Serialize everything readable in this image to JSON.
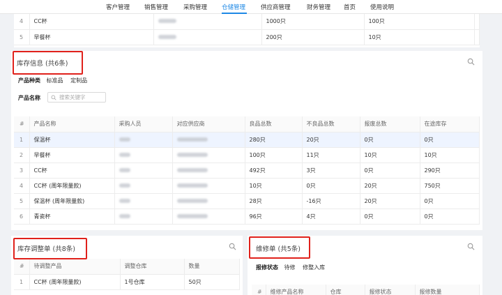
{
  "nav": {
    "items": [
      "客户管理",
      "销售管理",
      "采购管理",
      "仓储管理",
      "供应商管理",
      "财务管理",
      "首页",
      "使用说明"
    ],
    "active_index": 3
  },
  "top_table": {
    "rows": [
      {
        "idx": "4",
        "name": "CC杯",
        "qty": "1000只",
        "qty2": "100只"
      },
      {
        "idx": "5",
        "name": "早餐杯",
        "qty": "200只",
        "qty2": "10只"
      }
    ]
  },
  "inventory": {
    "title": "库存信息 (共6条)",
    "filter_category_label": "产品种类",
    "filter_category_options": [
      "标准品",
      "定制品"
    ],
    "filter_name_label": "产品名称",
    "search_placeholder": "搜索关键字",
    "columns": [
      "#",
      "产品名称",
      "采购人员",
      "对应供应商",
      "良品总数",
      "不良品总数",
      "报废总数",
      "在途库存"
    ],
    "rows": [
      {
        "idx": "1",
        "name": "保温杯",
        "good": "280只",
        "bad": "20只",
        "scrap": "0只",
        "transit": "0只"
      },
      {
        "idx": "2",
        "name": "早餐杯",
        "good": "100只",
        "bad": "11只",
        "scrap": "10只",
        "transit": "10只"
      },
      {
        "idx": "3",
        "name": "CC杯",
        "good": "492只",
        "bad": "3只",
        "scrap": "0只",
        "transit": "290只"
      },
      {
        "idx": "4",
        "name": "CC杯 (周年限量款)",
        "good": "10只",
        "bad": "0只",
        "scrap": "20只",
        "transit": "750只"
      },
      {
        "idx": "5",
        "name": "保温杯 (周年限量款)",
        "good": "28只",
        "bad": "-16只",
        "scrap": "20只",
        "transit": "0只"
      },
      {
        "idx": "6",
        "name": "青瓷杯",
        "good": "96只",
        "bad": "4只",
        "scrap": "0只",
        "transit": "0只"
      }
    ]
  },
  "adjust": {
    "title": "库存调整单 (共8条)",
    "columns": [
      "#",
      "待调整产品",
      "调整仓库",
      "数量"
    ],
    "rows": [
      {
        "idx": "1",
        "product": "CC杯 (周年限量款)",
        "warehouse": "1号仓库",
        "qty": "50只"
      }
    ]
  },
  "repair": {
    "title": "维修单 (共5条)",
    "filter_label": "报修状态",
    "filter_options": [
      "待修",
      "修整入库"
    ],
    "columns": [
      "#",
      "维修产品名称",
      "仓库",
      "报修状态",
      "报修数量"
    ]
  },
  "colors": {
    "accent": "#1e88e5",
    "highlight_box": "#e0211b"
  }
}
